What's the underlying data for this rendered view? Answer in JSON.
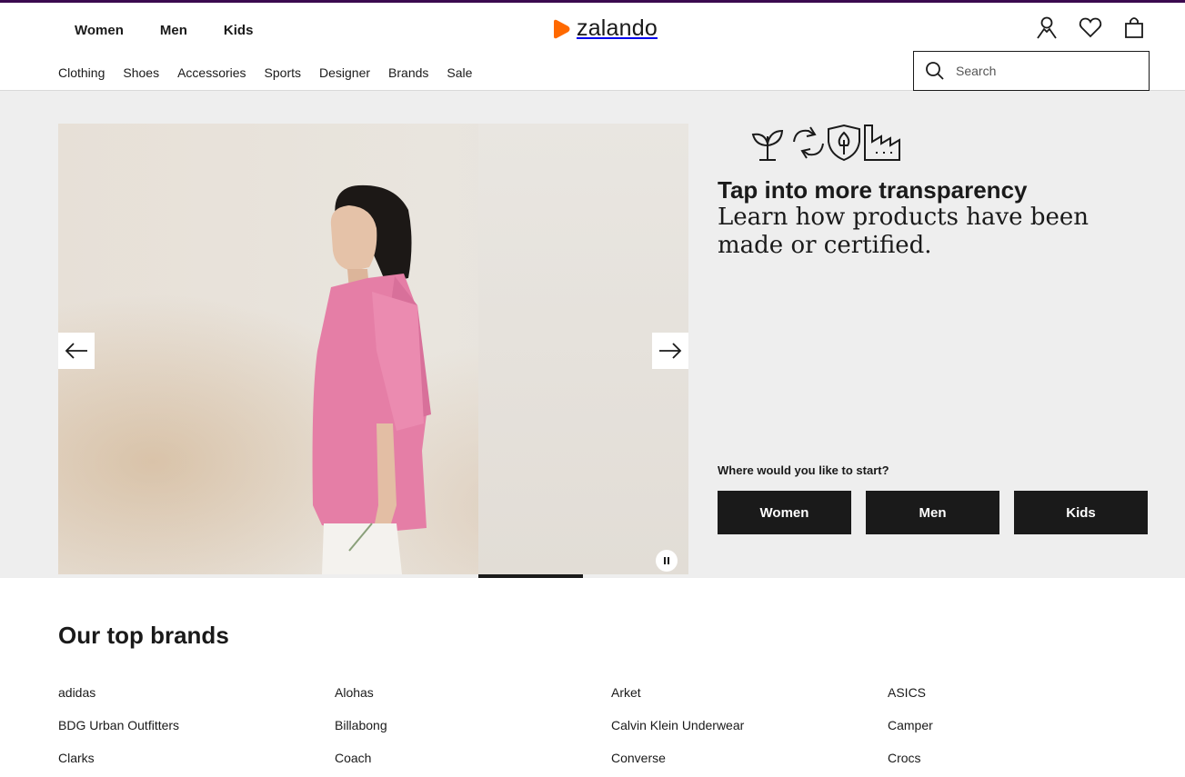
{
  "header": {
    "gender_nav": [
      "Women",
      "Men",
      "Kids"
    ],
    "logo_text": "zalando",
    "logo_color": "#ff6900",
    "icons": [
      "account-icon",
      "heart-icon",
      "bag-icon"
    ],
    "categories": [
      "Clothing",
      "Shoes",
      "Accessories",
      "Sports",
      "Designer",
      "Brands",
      "Sale"
    ],
    "search_placeholder": "Search"
  },
  "hero": {
    "title": "Tap into more transparency",
    "subtitle": "Learn how products have been made or certified.",
    "promo_icons": [
      "plant-icon",
      "recycle-icon",
      "shield-tree-icon",
      "factory-icon"
    ],
    "start_label": "Where would you like to start?",
    "start_buttons": [
      "Women",
      "Men",
      "Kids"
    ]
  },
  "brands": {
    "title": "Our top brands",
    "items": [
      "adidas",
      "Alohas",
      "Arket",
      "ASICS",
      "BDG Urban Outfitters",
      "Billabong",
      "Calvin Klein Underwear",
      "Camper",
      "Clarks",
      "Coach",
      "Converse",
      "Crocs"
    ]
  },
  "colors": {
    "accent_bar": "#3b0a4f",
    "button_bg": "#1a1a1a",
    "hero_bg": "#eeeeee"
  }
}
